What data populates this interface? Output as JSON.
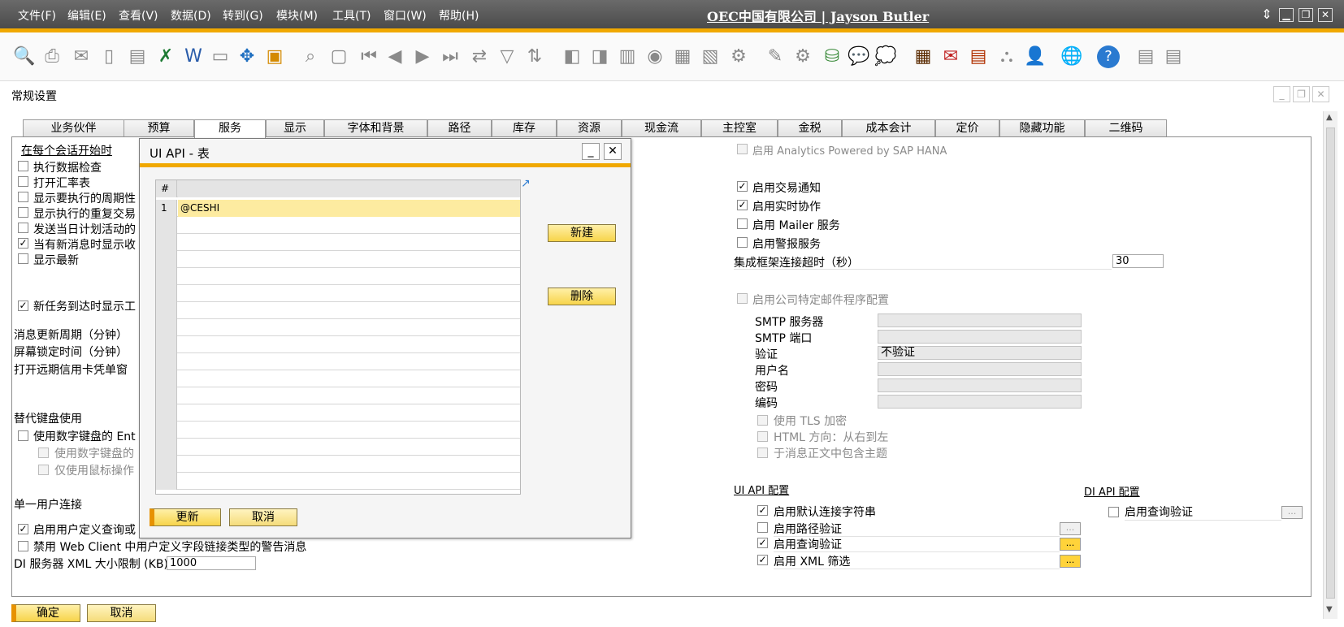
{
  "menubar": {
    "items": [
      "文件(F)",
      "编辑(E)",
      "查看(V)",
      "数据(D)",
      "转到(G)",
      "模块(M)",
      "工具(T)",
      "窗口(W)",
      "帮助(H)"
    ],
    "company": "OEC中国有限公司 | Jayson Butler"
  },
  "colors": {
    "accent": "#f0a800",
    "menubar": "#555555",
    "button": "#f7d44a"
  },
  "window": {
    "title": "常规设置"
  },
  "tabs": [
    "业务伙伴",
    "预算",
    "服务",
    "显示",
    "字体和背景",
    "路径",
    "库存",
    "资源",
    "现金流",
    "主控室",
    "金税",
    "成本会计",
    "定价",
    "隐藏功能",
    "二维码"
  ],
  "active_tab": "服务",
  "left": {
    "session_heading": "在每个会话开始时",
    "session_items": [
      {
        "label": "执行数据检查",
        "checked": false
      },
      {
        "label": "打开汇率表",
        "checked": false
      },
      {
        "label": "显示要执行的周期性",
        "checked": false
      },
      {
        "label": "显示执行的重复交易",
        "checked": false
      },
      {
        "label": "发送当日计划活动的",
        "checked": false
      },
      {
        "label": "当有新消息时显示收",
        "checked": true
      },
      {
        "label": "显示最新",
        "checked": false
      }
    ],
    "new_task": {
      "label": "新任务到达时显示工",
      "checked": true
    },
    "msg_period": "消息更新周期（分钟）",
    "lock_time": "屏幕锁定时间（分钟）",
    "open_credit": "打开远期信用卡凭单窗",
    "alt_keyboard": "替代键盘使用",
    "use_numpad": "使用数字键盘的 Ent",
    "use_numpad_sub": "使用数字键盘的",
    "mouse_only": "仅使用鼠标操作",
    "single_user": "单一用户连接",
    "enable_udq": "启用用户定义查询或",
    "disable_webclient": "禁用 Web Client 中用户定义字段链接类型的警告消息",
    "xml_limit_label": "DI 服务器 XML 大小限制 (KB)",
    "xml_limit_value": "1000"
  },
  "right": {
    "analytics": "启用 Analytics Powered by SAP HANA",
    "txn_notify": "启用交易通知",
    "realtime": "启用实时协作",
    "mailer": "启用 Mailer 服务",
    "alert": "启用警报服务",
    "timeout_label": "集成框架连接超时（秒）",
    "timeout_value": "30",
    "company_mail": "启用公司特定邮件程序配置",
    "smtp_server": "SMTP 服务器",
    "smtp_port": "SMTP 端口",
    "auth": "验证",
    "auth_value": "不验证",
    "username": "用户名",
    "password": "密码",
    "encoding": "编码",
    "tls": "使用 TLS 加密",
    "html_dir": "HTML 方向：从右到左",
    "subject_in_body": "于消息正文中包含主题",
    "ui_api_heading": "UI API 配置",
    "ui_default_conn": "启用默认连接字符串",
    "ui_path_verify": "启用路径验证",
    "ui_query_verify": "启用查询验证",
    "ui_xml_filter": "启用 XML 筛选",
    "di_api_heading": "DI API 配置",
    "di_query_verify": "启用查询验证",
    "dots": "..."
  },
  "footer": {
    "ok": "确定",
    "cancel": "取消"
  },
  "dialog": {
    "title": "UI API - 表",
    "col_header": "#",
    "rows": [
      {
        "num": "1",
        "value": "@CESHI"
      }
    ],
    "new_button": "新建",
    "delete_button": "删除",
    "update_button": "更新",
    "cancel_button": "取消",
    "minimize": "_",
    "close": "✕"
  }
}
